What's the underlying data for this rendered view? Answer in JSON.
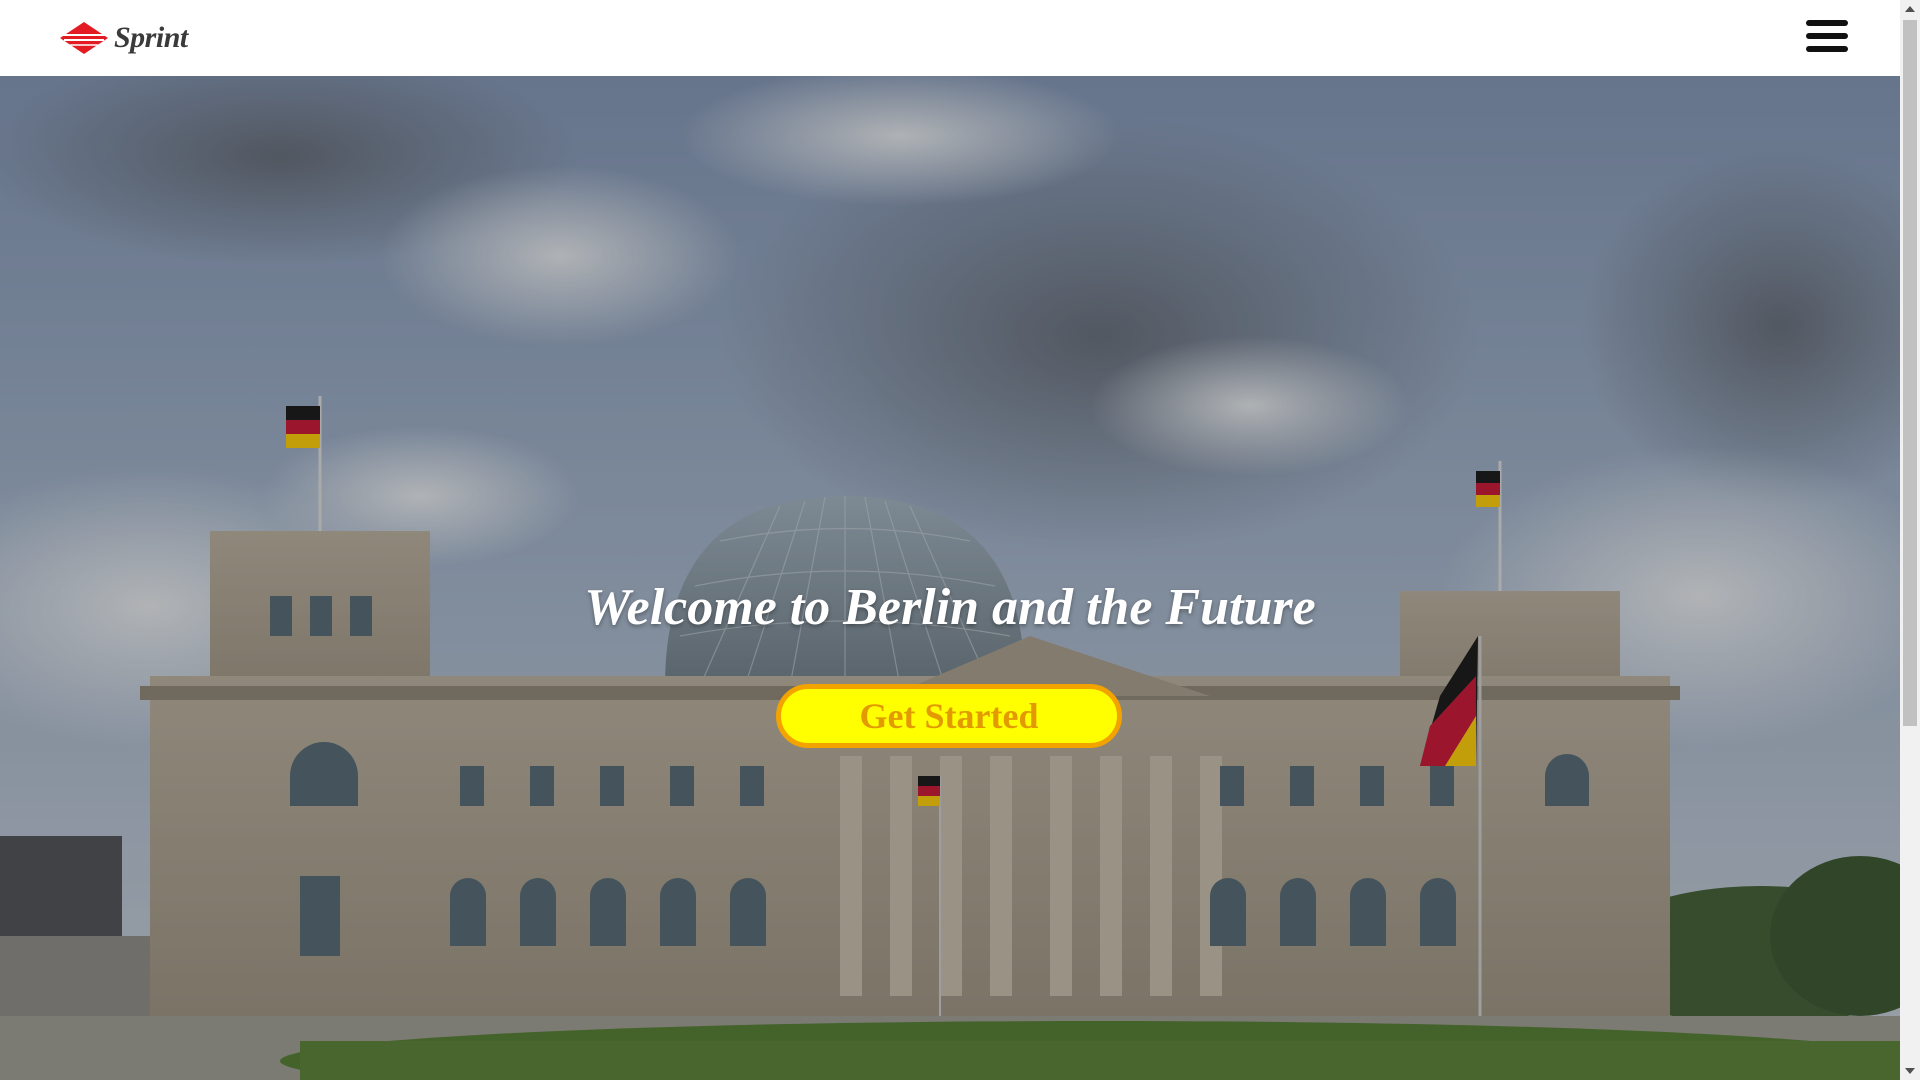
{
  "header": {
    "logo_text": "Sprint",
    "logo_mark": "",
    "menu_icon": "hamburger-menu-icon"
  },
  "hero": {
    "title": "Welcome to Berlin and the Future",
    "cta_label": "Get Started",
    "background": "reichstag-building-photo"
  },
  "colors": {
    "cta_fill": "#ffff00",
    "cta_border": "#f2a300",
    "cta_text": "#e39a00",
    "logo_red": "#e31b23",
    "header_bg": "#ffffff"
  }
}
